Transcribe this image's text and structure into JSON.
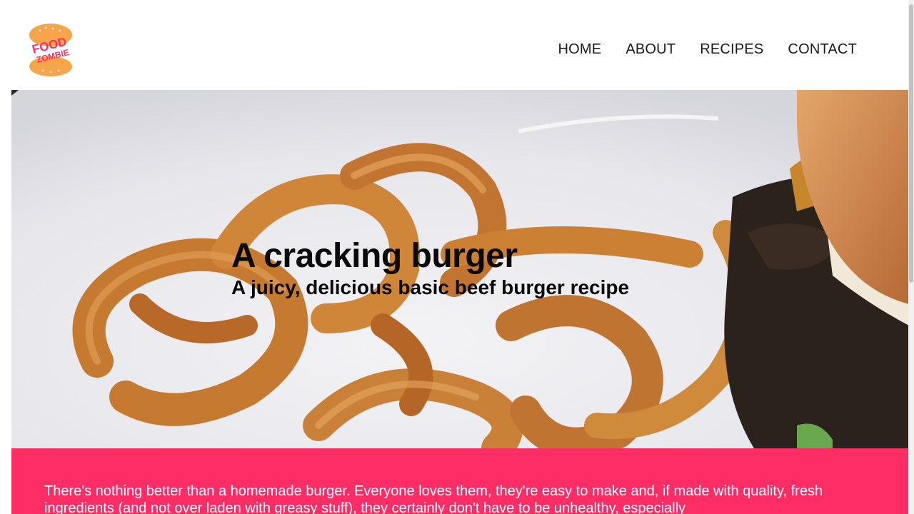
{
  "brand": {
    "logo_line1": "FOOD",
    "logo_line2": "ZOMBIE",
    "colors": {
      "logo_bun": "#f6a54a",
      "logo_text": "#ff2d66",
      "accent": "#ff2d66"
    }
  },
  "nav": {
    "items": [
      {
        "label": "HOME"
      },
      {
        "label": "ABOUT"
      },
      {
        "label": "RECIPES"
      },
      {
        "label": "CONTACT"
      }
    ]
  },
  "hero": {
    "title": "A cracking burger",
    "subtitle": "A juicy, delicious basic beef burger recipe",
    "image": "burger-and-onion-rings-photo"
  },
  "intro": {
    "text": "There's nothing better than a homemade burger. Everyone loves them, they're easy to make and, if made with quality, fresh ingredients (and not over laden with greasy stuff), they certainly don't have to be unhealthy, especially"
  }
}
